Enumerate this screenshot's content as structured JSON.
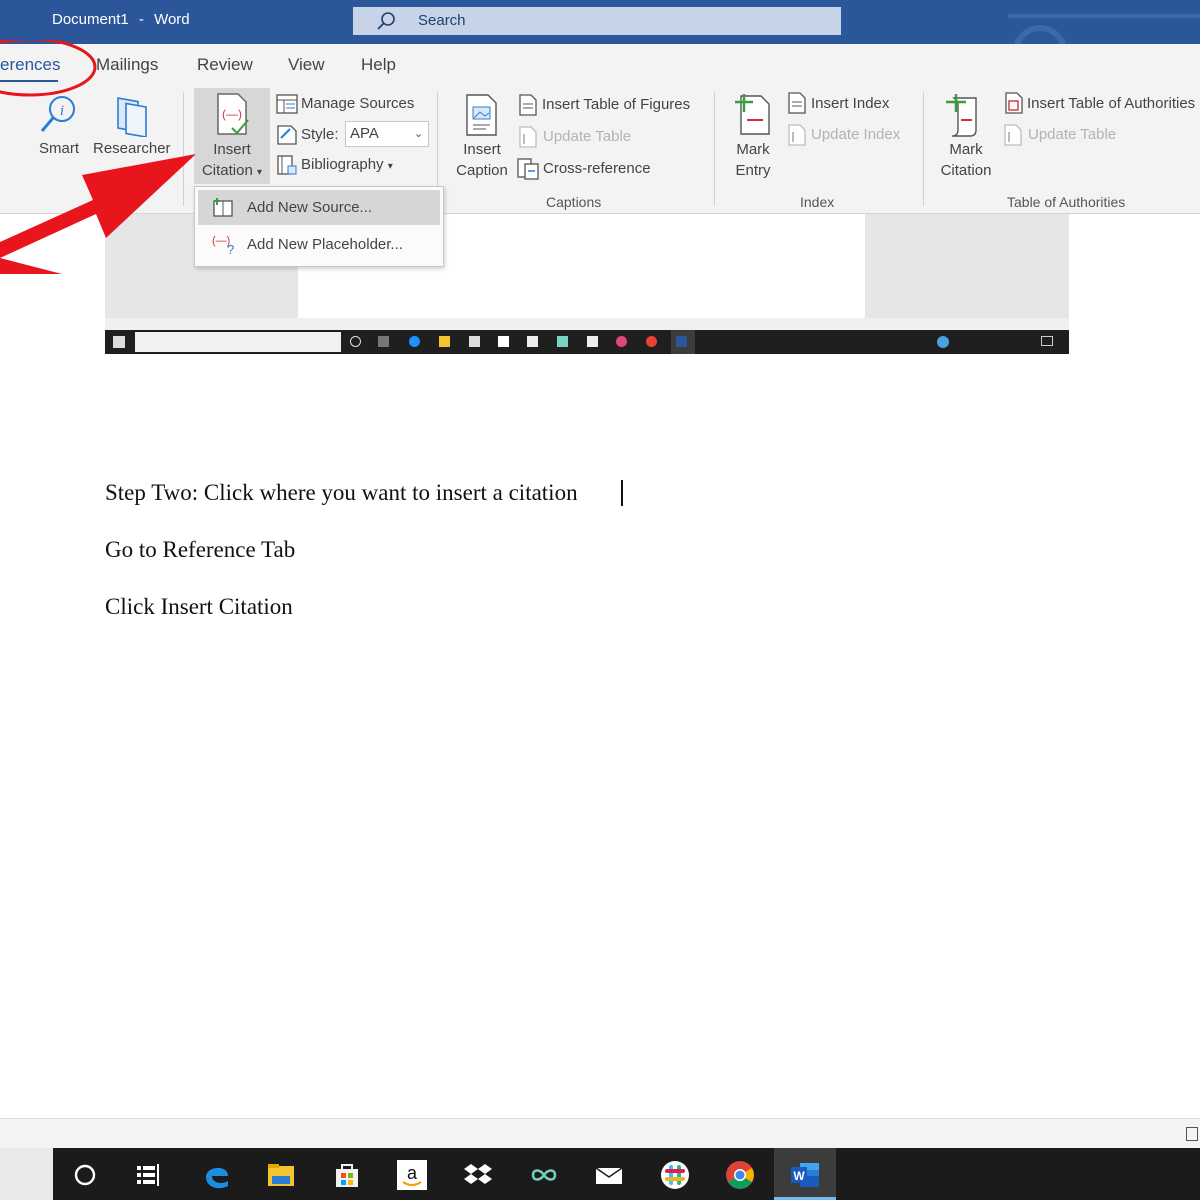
{
  "titlebar": {
    "doc_name": "Document1",
    "separator": "-",
    "app_name": "Word",
    "search_placeholder": "Search"
  },
  "tabs": [
    {
      "label": "erences",
      "active": true
    },
    {
      "label": "Mailings"
    },
    {
      "label": "Review"
    },
    {
      "label": "View"
    },
    {
      "label": "Help"
    }
  ],
  "ribbon": {
    "research": {
      "smart_label": "Smart",
      "researcher_label": "Researcher"
    },
    "citations": {
      "insert_citation_line1": "Insert",
      "insert_citation_line2": "Citation",
      "manage_sources": "Manage Sources",
      "style_label": "Style:",
      "style_value": "APA",
      "bibliography": "Bibliography"
    },
    "captions": {
      "insert_caption_line1": "Insert",
      "insert_caption_line2": "Caption",
      "insert_table_of_figures": "Insert Table of Figures",
      "update_table": "Update Table",
      "cross_reference": "Cross-reference",
      "group_label": "Captions"
    },
    "index": {
      "mark_entry_line1": "Mark",
      "mark_entry_line2": "Entry",
      "insert_index": "Insert Index",
      "update_index": "Update Index",
      "group_label": "Index"
    },
    "authorities": {
      "mark_citation_line1": "Mark",
      "mark_citation_line2": "Citation",
      "insert_table_of_authorities": "Insert Table of Authorities",
      "update_table": "Update Table",
      "group_label": "Table of Authorities"
    }
  },
  "dropdown": {
    "add_new_source": "Add New Source...",
    "add_new_placeholder": "Add New Placeholder..."
  },
  "document": {
    "line1": "Step Two:  Click where you want to insert a citation",
    "line2": "Go to Reference Tab",
    "line3": "Click Insert Citation"
  },
  "colors": {
    "word_blue": "#2b579a",
    "annotation_red": "#e8161c",
    "taskbar": "#1b1b1b"
  },
  "taskbar_icons": [
    "cortana-circle-icon",
    "task-view-icon",
    "edge-icon",
    "file-explorer-icon",
    "store-icon",
    "amazon-icon",
    "dropbox-icon",
    "infinity-icon",
    "mail-icon",
    "slack-icon",
    "chrome-icon",
    "word-icon"
  ]
}
